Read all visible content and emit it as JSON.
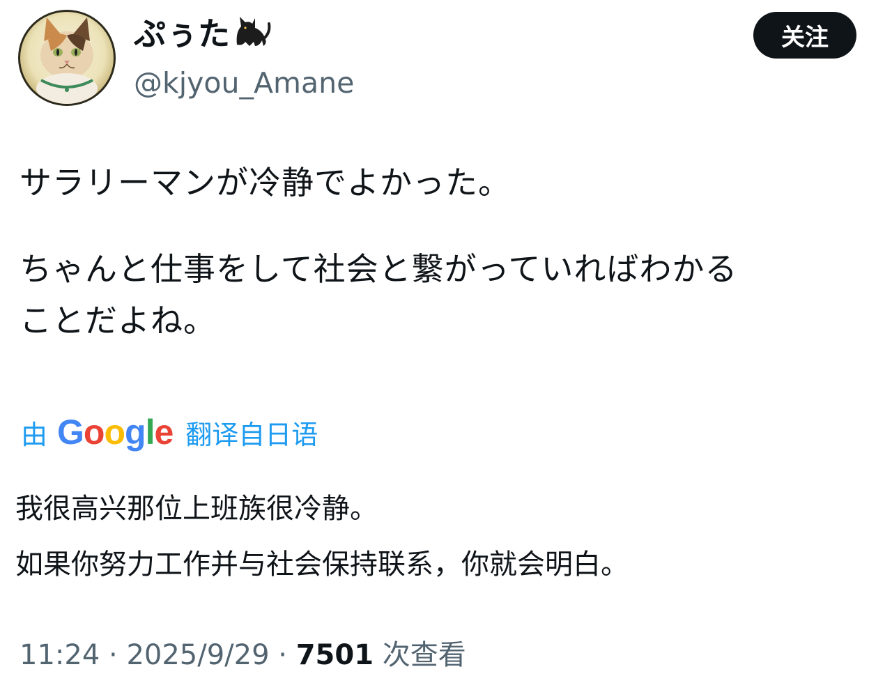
{
  "user": {
    "display_name": "ぷぅた",
    "handle": "@kjyou_Amane",
    "avatar_icon": "cat-portrait-avatar",
    "name_emoji_icon": "black-cat-icon"
  },
  "follow_button": {
    "label": "关注"
  },
  "tweet": {
    "lines": [
      "サラリーマンが冷静でよかった。",
      "ちゃんと仕事をして社会と繋がっていればわかる",
      "ことだよね。"
    ]
  },
  "translate": {
    "prefix": "由",
    "brand": "Google",
    "suffix": "翻译自日语"
  },
  "translation": {
    "lines": [
      "我很高兴那位上班族很冷静。",
      "如果你努力工作并与社会保持联系，你就会明白。"
    ]
  },
  "meta": {
    "time": "11:24",
    "date": "2025/9/29",
    "views": "7501",
    "views_label": "次查看",
    "separator": "·"
  },
  "colors": {
    "text": "#0f1419",
    "secondary": "#536471",
    "link": "#1d9bf0",
    "button_bg": "#0f1419"
  }
}
